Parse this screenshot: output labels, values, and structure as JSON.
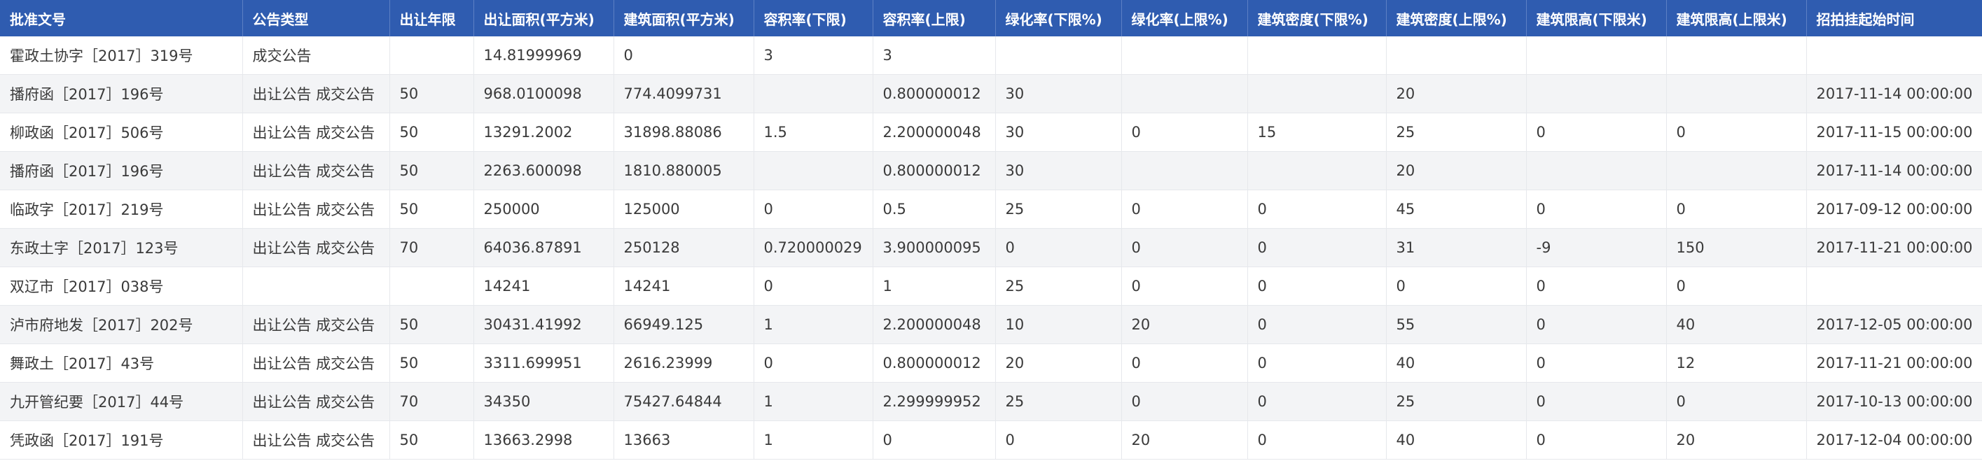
{
  "table": {
    "columns": [
      "批准文号",
      "公告类型",
      "出让年限",
      "出让面积(平方米)",
      "建筑面积(平方米)",
      "容积率(下限)",
      "容积率(上限)",
      "绿化率(下限%)",
      "绿化率(上限%)",
      "建筑密度(下限%)",
      "建筑密度(上限%)",
      "建筑限高(下限米)",
      "建筑限高(上限米)",
      "招拍挂起始时间"
    ],
    "rows": [
      [
        "霍政土协字［2017］319号",
        "成交公告",
        "",
        "14.81999969",
        "0",
        "3",
        "3",
        "",
        "",
        "",
        "",
        "",
        "",
        ""
      ],
      [
        "播府函［2017］196号",
        "出让公告 成交公告",
        "50",
        "968.0100098",
        "774.4099731",
        "",
        "0.800000012",
        "30",
        "",
        "",
        "20",
        "",
        "",
        "2017-11-14 00:00:00"
      ],
      [
        "柳政函［2017］506号",
        "出让公告 成交公告",
        "50",
        "13291.2002",
        "31898.88086",
        "1.5",
        "2.200000048",
        "30",
        "0",
        "15",
        "25",
        "0",
        "0",
        "2017-11-15 00:00:00"
      ],
      [
        "播府函［2017］196号",
        "出让公告 成交公告",
        "50",
        "2263.600098",
        "1810.880005",
        "",
        "0.800000012",
        "30",
        "",
        "",
        "20",
        "",
        "",
        "2017-11-14 00:00:00"
      ],
      [
        "临政字［2017］219号",
        "出让公告 成交公告",
        "50",
        "250000",
        "125000",
        "0",
        "0.5",
        "25",
        "0",
        "0",
        "45",
        "0",
        "0",
        "2017-09-12 00:00:00"
      ],
      [
        "东政土字［2017］123号",
        "出让公告 成交公告",
        "70",
        "64036.87891",
        "250128",
        "0.720000029",
        "3.900000095",
        "0",
        "0",
        "0",
        "31",
        "-9",
        "150",
        "2017-11-21 00:00:00"
      ],
      [
        "双辽市［2017］038号",
        "",
        "",
        "14241",
        "14241",
        "0",
        "1",
        "25",
        "0",
        "0",
        "0",
        "0",
        "0",
        ""
      ],
      [
        "泸市府地发［2017］202号",
        "出让公告 成交公告",
        "50",
        "30431.41992",
        "66949.125",
        "1",
        "2.200000048",
        "10",
        "20",
        "0",
        "55",
        "0",
        "40",
        "2017-12-05 00:00:00"
      ],
      [
        "舞政土［2017］43号",
        "出让公告 成交公告",
        "50",
        "3311.699951",
        "2616.23999",
        "0",
        "0.800000012",
        "20",
        "0",
        "0",
        "40",
        "0",
        "12",
        "2017-11-21 00:00:00"
      ],
      [
        "九开管纪要［2017］44号",
        "出让公告 成交公告",
        "70",
        "34350",
        "75427.64844",
        "1",
        "2.299999952",
        "25",
        "0",
        "0",
        "25",
        "0",
        "0",
        "2017-10-13 00:00:00"
      ],
      [
        "凭政函［2017］191号",
        "出让公告 成交公告",
        "50",
        "13663.2998",
        "13663",
        "1",
        "0",
        "0",
        "20",
        "0",
        "40",
        "0",
        "20",
        "2017-12-04 00:00:00"
      ]
    ]
  },
  "colors": {
    "header_bg": "#2f5cb0",
    "header_text": "#ffffff",
    "row_alt_bg": "#f3f4f6",
    "border": "#e6e8ec"
  }
}
